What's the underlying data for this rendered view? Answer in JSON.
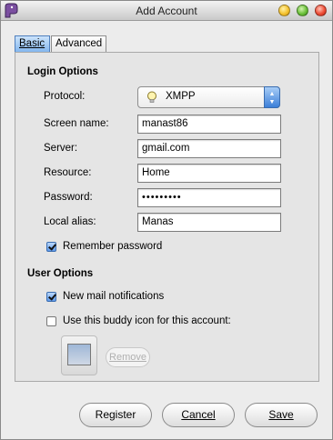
{
  "window": {
    "title": "Add Account"
  },
  "tabs": [
    {
      "label": "Basic",
      "selected": true
    },
    {
      "label": "Advanced",
      "selected": false
    }
  ],
  "login_options": {
    "title": "Login Options",
    "protocol": {
      "label": "Protocol:",
      "value": "XMPP",
      "icon": "lightbulb-icon"
    },
    "screen_name": {
      "label": "Screen name:",
      "value": "manast86"
    },
    "server": {
      "label": "Server:",
      "value": "gmail.com"
    },
    "resource": {
      "label": "Resource:",
      "value": "Home"
    },
    "password": {
      "label": "Password:",
      "value": "•••••••••"
    },
    "local_alias": {
      "label": "Local alias:",
      "value": "Manas"
    },
    "remember_password": {
      "label": "Remember password",
      "checked": true
    }
  },
  "user_options": {
    "title": "User Options",
    "new_mail": {
      "label": "New mail notifications",
      "checked": true
    },
    "buddy_icon": {
      "label": "Use this buddy icon for this account:",
      "checked": false
    },
    "remove_label": "Remove"
  },
  "buttons": {
    "register": "Register",
    "cancel": "Cancel",
    "save": "Save"
  },
  "colors": {
    "window_bg": "#ececec",
    "selected_tab": "#80b4ee",
    "accent": "#3c7fd8"
  }
}
